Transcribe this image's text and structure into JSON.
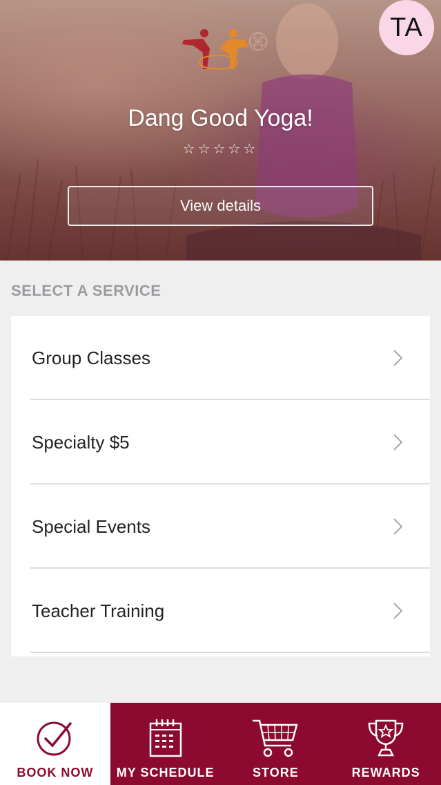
{
  "header": {
    "avatar_initials": "TA",
    "studio_name": "Dang Good Yoga!",
    "rating_stars": "☆☆☆☆☆",
    "view_details_label": "View details"
  },
  "services": {
    "section_title": "SELECT A SERVICE",
    "items": [
      {
        "label": "Group Classes"
      },
      {
        "label": "Specialty $5"
      },
      {
        "label": "Special Events"
      },
      {
        "label": "Teacher Training"
      }
    ]
  },
  "tabbar": {
    "tabs": [
      {
        "label": "BOOK NOW",
        "icon": "checkmark-circle-icon",
        "active": true
      },
      {
        "label": "MY SCHEDULE",
        "icon": "calendar-icon",
        "active": false
      },
      {
        "label": "STORE",
        "icon": "shopping-cart-icon",
        "active": false
      },
      {
        "label": "REWARDS",
        "icon": "trophy-icon",
        "active": false
      }
    ]
  },
  "colors": {
    "brand": "#8c0a2f",
    "avatar_bg": "#fad7e6",
    "background": "#efeff0"
  }
}
